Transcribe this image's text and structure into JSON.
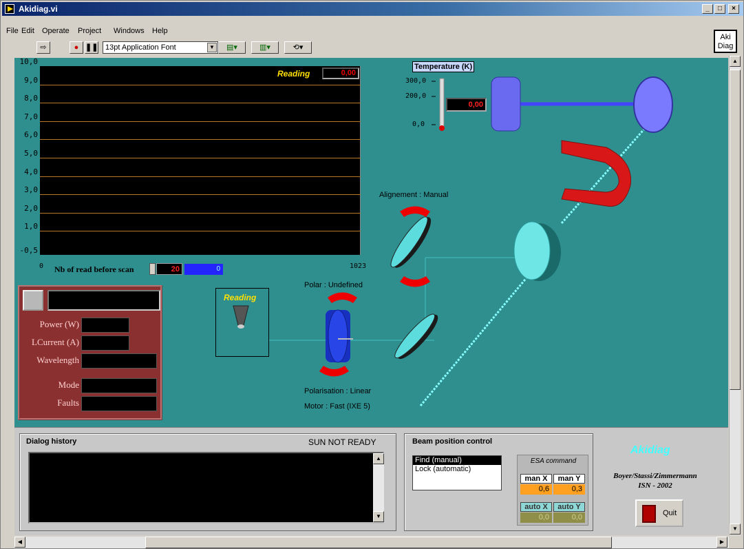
{
  "window": {
    "title": "Akidiag.vi",
    "logo": "Aki Diag"
  },
  "menu": [
    "File",
    "Edit",
    "Operate",
    "Project",
    "Windows",
    "Help"
  ],
  "toolbar": {
    "font": "13pt Application Font"
  },
  "graph": {
    "reading_label": "Reading",
    "reading_value": "0,00",
    "y_ticks": [
      "10,0",
      "9,0",
      "8,0",
      "7,0",
      "6,0",
      "5,0",
      "4,0",
      "3,0",
      "2,0",
      "1,0",
      "-0,5"
    ],
    "x_min": "0",
    "x_max": "1023",
    "nb_read_label": "Nb of read before scan",
    "nb_read_value": "20",
    "progress_value": "0"
  },
  "laser": {
    "labels": [
      "Power (W)",
      "LCurrent (A)",
      "Wavelength",
      "Mode",
      "Faults"
    ]
  },
  "setup": {
    "detector_label": "Reading",
    "alignment": "Alignement : Manual",
    "polar": "Polar : Undefined",
    "polarisation": "Polarisation : Linear",
    "motor": "Motor : Fast (IXE 5)",
    "temperature_label": "Temperature (K)",
    "temp_ticks": [
      "300,0",
      "200,0",
      "0,0"
    ],
    "temperature_value": "0,00"
  },
  "dialog": {
    "title": "Dialog history",
    "status": "SUN NOT READY"
  },
  "beam": {
    "title": "Beam position control",
    "options": [
      "Find (manual)",
      "Lock (automatic)"
    ],
    "selected": 0,
    "esa_title": "ESA command",
    "man_x_label": "man X",
    "man_y_label": "man Y",
    "man_x": "0,6",
    "man_y": "0,3",
    "auto_x_label": "auto X",
    "auto_y_label": "auto Y",
    "auto_x": "0,0",
    "auto_y": "0,0"
  },
  "about": {
    "name": "Akidiag",
    "authors": "Boyer/Stassi/Zimmermann",
    "lab": "ISN - 2002",
    "quit": "Quit"
  }
}
